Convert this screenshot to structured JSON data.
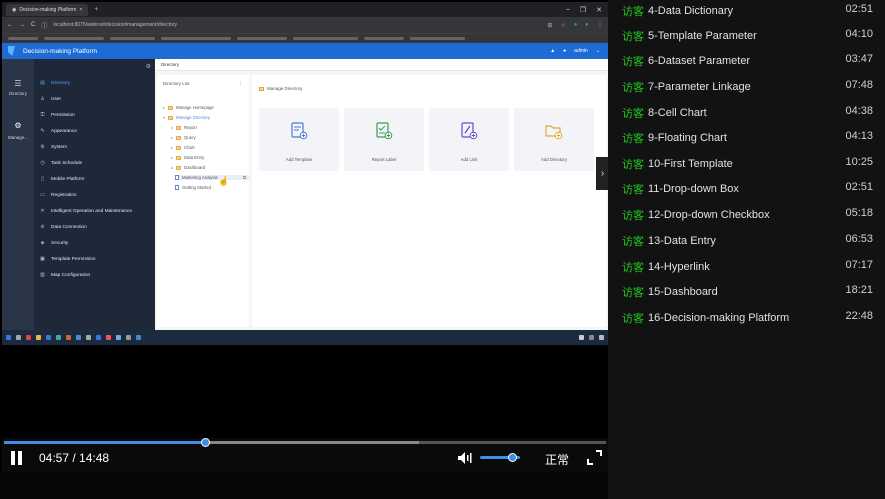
{
  "browser": {
    "tab_title": "Decision-making Platform",
    "url": "localhost:8075/webroot/decision#management/directory"
  },
  "app": {
    "title": "Decision-making Platform",
    "user": "admin"
  },
  "iconstrip": {
    "directory_label": "Directory",
    "manage_label": "Manage..."
  },
  "sidebar": {
    "items": [
      {
        "label": "Directory",
        "icon": "folder-icon"
      },
      {
        "label": "User",
        "icon": "user-icon"
      },
      {
        "label": "Permission",
        "icon": "lock-icon"
      },
      {
        "label": "Appearance",
        "icon": "palette-icon"
      },
      {
        "label": "System",
        "icon": "gear-icon"
      },
      {
        "label": "Task Schedule",
        "icon": "clock-icon"
      },
      {
        "label": "Mobile Platform",
        "icon": "mobile-icon"
      },
      {
        "label": "Registration",
        "icon": "registration-icon"
      },
      {
        "label": "Intelligent Operation and Maintenance",
        "icon": "tools-icon"
      },
      {
        "label": "Data Connection",
        "icon": "link-icon"
      },
      {
        "label": "Security",
        "icon": "shield-icon"
      },
      {
        "label": "Template Permission",
        "icon": "template-icon"
      },
      {
        "label": "Map Configuration",
        "icon": "map-icon"
      }
    ]
  },
  "content": {
    "tab": "Directory",
    "directory_list_title": "Directory List",
    "breadcrumb": "Manage Directory",
    "tree": [
      {
        "label": "Manage Homepage",
        "type": "folder"
      },
      {
        "label": "Manage Directory",
        "type": "folder"
      },
      {
        "label": "Report",
        "type": "folder"
      },
      {
        "label": "Query",
        "type": "folder"
      },
      {
        "label": "Chart",
        "type": "folder"
      },
      {
        "label": "Data Entry",
        "type": "folder"
      },
      {
        "label": "Dashboard",
        "type": "folder"
      },
      {
        "label": "Marketing Analysis",
        "type": "file"
      },
      {
        "label": "Getting Started",
        "type": "file"
      }
    ],
    "cards": [
      {
        "label": "Add Template",
        "icon": "template-add-icon"
      },
      {
        "label": "Report Label",
        "icon": "report-label-icon"
      },
      {
        "label": "Add Link",
        "icon": "link-add-icon"
      },
      {
        "label": "Add Directory",
        "icon": "folder-add-icon"
      }
    ]
  },
  "player": {
    "current_time": "04:57",
    "total_time": "14:48",
    "time_display": "04:57 / 14:48",
    "progress_fraction": 0.335,
    "buffer_fraction": 0.69,
    "volume_fraction": 0.8,
    "speed_label": "正常"
  },
  "playlist": {
    "visitor_tag": "访客",
    "items": [
      {
        "title": "4-Data Dictionary",
        "duration": "02:51"
      },
      {
        "title": "5-Template Parameter",
        "duration": "04:10"
      },
      {
        "title": "6-Dataset Parameter",
        "duration": "03:47"
      },
      {
        "title": "7-Parameter Linkage",
        "duration": "07:48"
      },
      {
        "title": "8-Cell Chart",
        "duration": "04:38"
      },
      {
        "title": "9-Floating Chart",
        "duration": "04:13"
      },
      {
        "title": "10-First Template",
        "duration": "10:25"
      },
      {
        "title": "11-Drop-down Box",
        "duration": "02:51"
      },
      {
        "title": "12-Drop-down Checkbox",
        "duration": "05:18"
      },
      {
        "title": "13-Data Entry",
        "duration": "06:53"
      },
      {
        "title": "14-Hyperlink",
        "duration": "07:17"
      },
      {
        "title": "15-Dashboard",
        "duration": "18:21"
      },
      {
        "title": "16-Decision-making Platform",
        "duration": "22:48"
      }
    ]
  },
  "colors": {
    "accent": "#3d8ee7",
    "visitor": "#1fc81f",
    "app_header": "#1f6bd6",
    "sidebar_bg": "#1f2838"
  }
}
